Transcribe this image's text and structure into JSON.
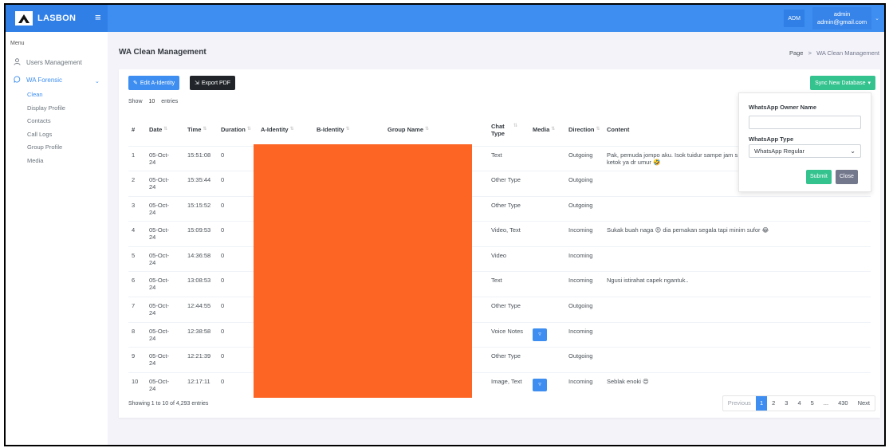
{
  "header": {
    "brand": "LASBON",
    "user_badge": "ADM",
    "user_name": "admin",
    "user_email": "admin@gmail.com"
  },
  "sidebar": {
    "menu_title": "Menu",
    "items": [
      {
        "label": "Users Management",
        "icon": "user-icon"
      },
      {
        "label": "WA Forensic",
        "icon": "chat-icon"
      }
    ],
    "sub_items": [
      "Clean",
      "Display Profile",
      "Contacts",
      "Call Logs",
      "Group Profile",
      "Media"
    ]
  },
  "page": {
    "title": "WA Clean Management",
    "breadcrumb_root": "Page",
    "breadcrumb_sep": ">",
    "breadcrumb_current": "WA Clean Management"
  },
  "toolbar": {
    "edit_label": "Edit A-Identity",
    "export_label": "Export PDF",
    "sync_label": "Sync New Database"
  },
  "entries": {
    "show": "Show",
    "value": "10",
    "label": "entries"
  },
  "table": {
    "headers": [
      "#",
      "Date",
      "Time",
      "Duration",
      "A-Identity",
      "B-Identity",
      "Group Name",
      "Chat Type",
      "Media",
      "Direction",
      "Content"
    ],
    "rows": [
      {
        "n": "1",
        "date": "05-Oct-24",
        "time": "15:51:08",
        "duration": "0",
        "chat_type": "Text",
        "media": "",
        "direction": "Outgoing",
        "content": "Pak, pemuda jompo aku. Isok tuidur sampe jam s ketok ya dr umur 🤣"
      },
      {
        "n": "2",
        "date": "05-Oct-24",
        "time": "15:35:44",
        "duration": "0",
        "chat_type": "Other Type",
        "media": "",
        "direction": "Outgoing",
        "content": ""
      },
      {
        "n": "3",
        "date": "05-Oct-24",
        "time": "15:15:52",
        "duration": "0",
        "chat_type": "Other Type",
        "media": "",
        "direction": "Outgoing",
        "content": ""
      },
      {
        "n": "4",
        "date": "05-Oct-24",
        "time": "15:09:53",
        "duration": "0",
        "chat_type": "Video, Text",
        "media": "",
        "direction": "Incoming",
        "content": "Sukak buah naga 😍 dia pemakan segala tapi minim sufor 😂"
      },
      {
        "n": "5",
        "date": "05-Oct-24",
        "time": "14:36:58",
        "duration": "0",
        "chat_type": "Video",
        "media": "",
        "direction": "Incoming",
        "content": ""
      },
      {
        "n": "6",
        "date": "05-Oct-24",
        "time": "13:08:53",
        "duration": "0",
        "chat_type": "Text",
        "media": "",
        "direction": "Incoming",
        "content": "Ngusi istirahat capek ngantuk.."
      },
      {
        "n": "7",
        "date": "05-Oct-24",
        "time": "12:44:55",
        "duration": "0",
        "chat_type": "Other Type",
        "media": "",
        "direction": "Outgoing",
        "content": ""
      },
      {
        "n": "8",
        "date": "05-Oct-24",
        "time": "12:38:58",
        "duration": "0",
        "chat_type": "Voice Notes",
        "media": "▿",
        "direction": "Incoming",
        "content": ""
      },
      {
        "n": "9",
        "date": "05-Oct-24",
        "time": "12:21:39",
        "duration": "0",
        "chat_type": "Other Type",
        "media": "",
        "direction": "Outgoing",
        "content": ""
      },
      {
        "n": "10",
        "date": "05-Oct-24",
        "time": "12:17:11",
        "duration": "0",
        "chat_type": "Image, Text",
        "media": "▿",
        "direction": "Incoming",
        "content": "Seblak enoki 😍"
      }
    ]
  },
  "footer": {
    "info": "Showing 1 to 10 of 4,293 entries",
    "pager": [
      "Previous",
      "1",
      "2",
      "3",
      "4",
      "5",
      "...",
      "430",
      "Next"
    ]
  },
  "dropdown": {
    "owner_label": "WhatsApp Owner Name",
    "owner_value": "",
    "type_label": "WhatsApp Type",
    "type_value": "WhatsApp Regular",
    "submit_label": "Submit",
    "close_label": "Close"
  },
  "colors": {
    "primary": "#3d8ef0",
    "success": "#34c38f",
    "redaction": "#fd6525",
    "dark": "#212529"
  }
}
